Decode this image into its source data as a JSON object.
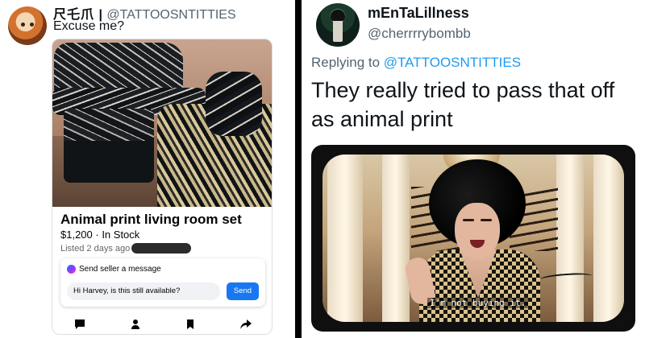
{
  "left_tweet": {
    "display_name": "尺乇爪 |",
    "handle": "@TATTOOSNTITTIES",
    "text": "Excuse me?",
    "listing": {
      "title": "Animal print living room set",
      "price_line": "$1,200 · In Stock",
      "listed_prefix": "Listed 2 days ago in",
      "message_header": "Send seller a message",
      "message_text": "Hi Harvey, is this still available?",
      "send_label": "Send"
    },
    "actions": [
      "message-icon",
      "profile-icon",
      "bookmark-icon",
      "share-icon"
    ]
  },
  "right_tweet": {
    "display_name": "mEnTaLillness",
    "handle": "@cherrrrybombb",
    "replying_prefix": "Replying to",
    "replying_to": "@TATTOOSNTITTIES",
    "text": "They really tried to pass that off as animal print",
    "media_subtitle": "I'm not buying it."
  },
  "colors": {
    "link": "#1d9bf0",
    "facebook_blue": "#1877f2",
    "secondary_text": "#536471"
  }
}
